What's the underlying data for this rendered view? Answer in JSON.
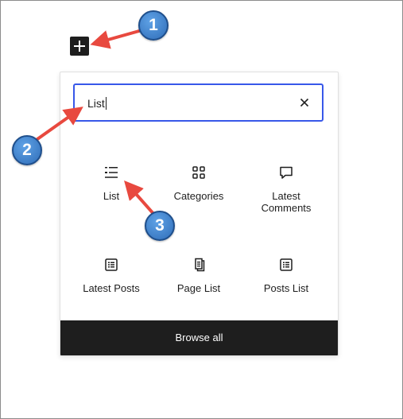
{
  "add_block_button": {
    "icon": "plus-icon"
  },
  "search": {
    "value": "List",
    "clear_icon": "close-icon"
  },
  "results": [
    {
      "label": "List",
      "icon": "list-icon"
    },
    {
      "label": "Categories",
      "icon": "categories-icon"
    },
    {
      "label": "Latest\nComments",
      "icon": "comment-icon"
    },
    {
      "label": "Latest Posts",
      "icon": "posts-list-icon"
    },
    {
      "label": "Page List",
      "icon": "page-list-icon"
    },
    {
      "label": "Posts List",
      "icon": "posts-list-icon"
    }
  ],
  "browse_all_label": "Browse all",
  "callouts": [
    "1",
    "2",
    "3"
  ],
  "colors": {
    "accent": "#3858e9",
    "dark": "#1e1e1e",
    "arrow": "#e8493f",
    "badge": "#3a7bd5"
  }
}
